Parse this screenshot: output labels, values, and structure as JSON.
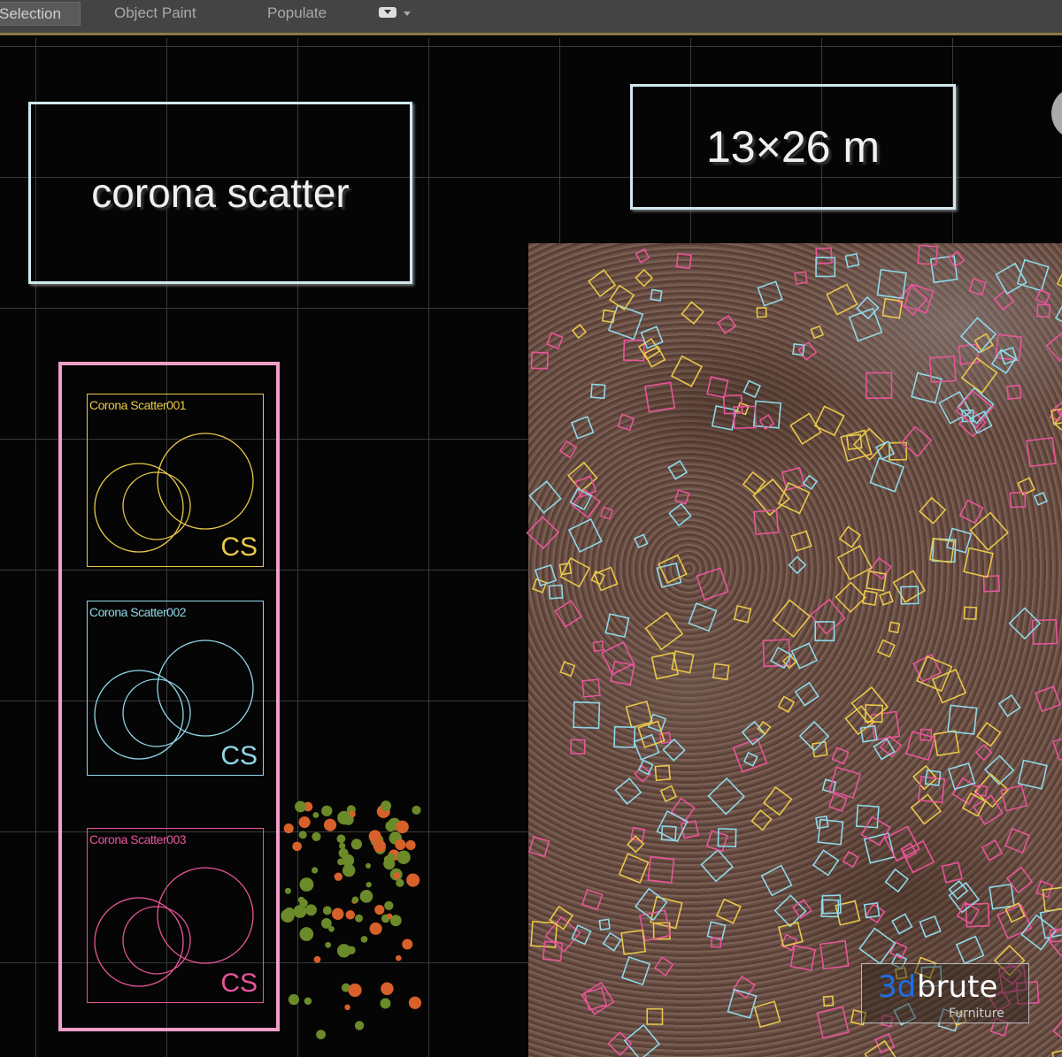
{
  "toolbar": {
    "tabs": [
      {
        "label": "Selection"
      },
      {
        "label": "Object Paint"
      },
      {
        "label": "Populate"
      }
    ],
    "dropdown_icon": "display-dropdown-icon"
  },
  "viewport": {
    "title_label": "corona scatter",
    "size_label": "13×26 m",
    "scatters": [
      {
        "name": "Corona Scatter001",
        "badge": "CS",
        "color": "#e8c84a"
      },
      {
        "name": "Corona Scatter002",
        "badge": "CS",
        "color": "#8fd8e8"
      },
      {
        "name": "Corona Scatter003",
        "badge": "CS",
        "color": "#e8559a"
      }
    ],
    "panel_color": "#f0a0c8"
  },
  "watermark": {
    "brand_prefix": "3d",
    "brand_suffix": "brute",
    "sub": "Furniture"
  }
}
